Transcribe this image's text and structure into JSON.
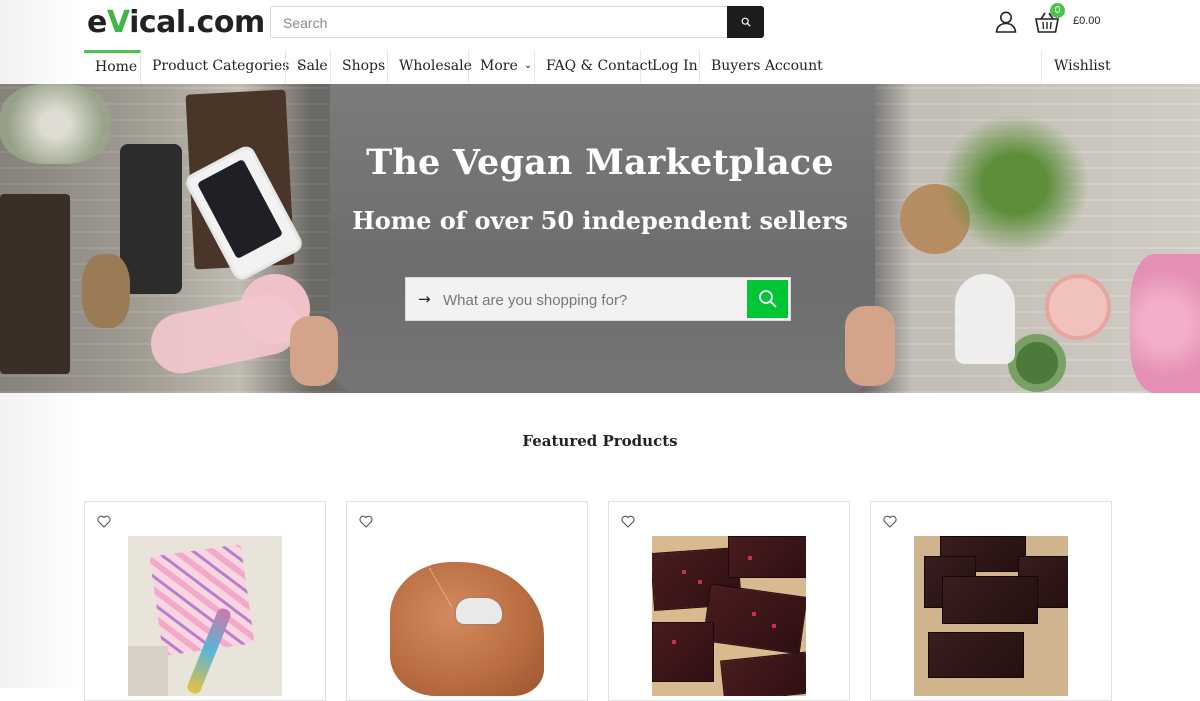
{
  "header": {
    "logo_prefix": "e",
    "logo_v": "V",
    "logo_suffix": "ical.com",
    "search_placeholder": "Search",
    "cart_count": "0",
    "cart_total": "£0.00"
  },
  "nav": {
    "items": [
      "Home",
      "Product Categories",
      "Sale",
      "Shops",
      "Wholesale",
      "More",
      "FAQ & Contact",
      "Log In",
      "Buyers Account"
    ],
    "wishlist": "Wishlist"
  },
  "hero": {
    "title": "The Vegan Marketplace",
    "subtitle": "Home of over 50 independent sellers",
    "search_placeholder": "What are you shopping for?"
  },
  "featured": {
    "title": "Featured Products"
  },
  "colors": {
    "accent_green": "#52c152",
    "search_button_green": "#00c636",
    "header_search_button": "#1c1c1c"
  }
}
